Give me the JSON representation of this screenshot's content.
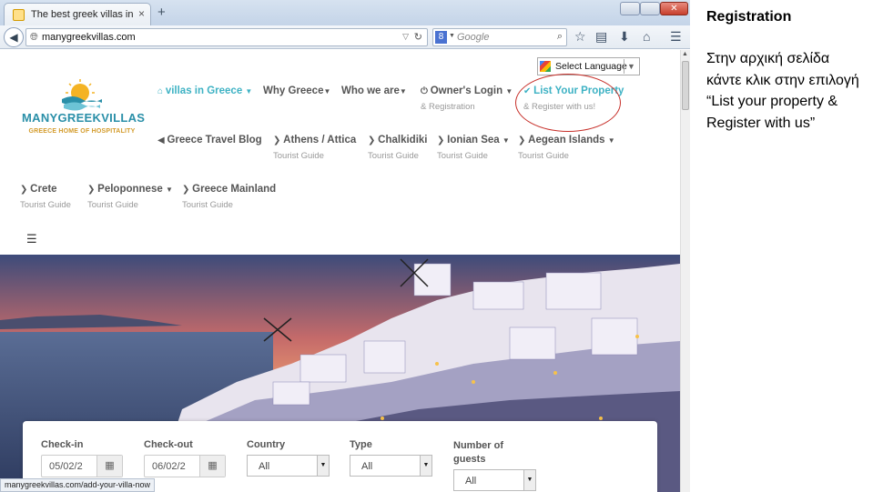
{
  "browser": {
    "tab_title": "The best greek villas in one...",
    "tab_close": "×",
    "new_tab": "+",
    "url": "manygreekvillas.com",
    "search_placeholder": "Google",
    "search_engine_letter": "8",
    "status_url": "manygreekvillas.com/add-your-villa-now",
    "icons": [
      "back-arrow-icon",
      "globe-icon",
      "reload-icon",
      "search-icon",
      "star-icon",
      "clipboard-icon",
      "download-icon",
      "home-icon",
      "menu-icon"
    ]
  },
  "site": {
    "language_select": "Select Language",
    "logo_name": "MANYGREEKVILLAS",
    "logo_tagline": "GREECE HOME OF HOSPITALITY",
    "menu_row1": [
      {
        "label": "villas in Greece",
        "sub": ""
      },
      {
        "label": "Why Greece",
        "sub": ""
      },
      {
        "label": "Who we are",
        "sub": ""
      },
      {
        "label": "Owner's Login",
        "sub": "& Registration"
      },
      {
        "label": "List Your Property",
        "sub": "& Register with us!"
      }
    ],
    "menu_row2": [
      {
        "label": "Greece Travel Blog",
        "sub": ""
      },
      {
        "label": "Athens / Attica",
        "sub": "Tourist Guide"
      },
      {
        "label": "Chalkidiki",
        "sub": "Tourist Guide"
      },
      {
        "label": "Ionian Sea",
        "sub": "Tourist Guide"
      },
      {
        "label": "Aegean Islands",
        "sub": "Tourist Guide"
      }
    ],
    "menu_row3": [
      {
        "label": "Crete",
        "sub": "Tourist Guide"
      },
      {
        "label": "Peloponnese",
        "sub": "Tourist Guide"
      },
      {
        "label": "Greece Mainland",
        "sub": "Tourist Guide"
      }
    ],
    "accent_color": "#3eb2c4",
    "highlight_circle_color": "#c7302a"
  },
  "search": {
    "checkin_label": "Check-in",
    "checkin_value": "05/02/2",
    "checkout_label": "Check-out",
    "checkout_value": "06/02/2",
    "country_label": "Country",
    "country_value": "All",
    "type_label": "Type",
    "type_value": "All",
    "guests_label": "Number of guests",
    "guests_value": "All"
  },
  "note": {
    "title": "Registration",
    "body": "Στην αρχική σελίδα\nκάντε κλικ στην επιλογή\n“List your property &\nRegister with us”"
  }
}
